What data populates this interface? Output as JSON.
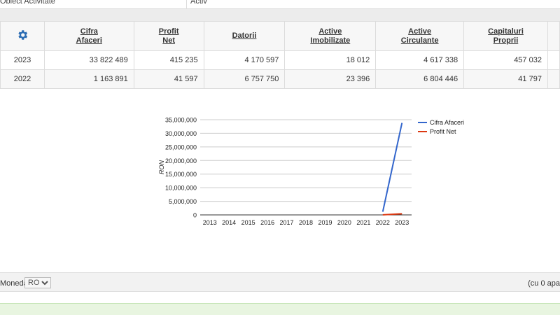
{
  "topbar": {
    "label": "Obiect Activitate",
    "value": "Activ"
  },
  "table": {
    "columns": [
      {
        "l1": "Cifra",
        "l2": "Afaceri"
      },
      {
        "l1": "Profit",
        "l2": "Net"
      },
      {
        "l1": "Datorii",
        "l2": ""
      },
      {
        "l1": "Active",
        "l2": "Imobilizate"
      },
      {
        "l1": "Active",
        "l2": "Circulante"
      },
      {
        "l1": "Capitaluri",
        "l2": "Proprii"
      }
    ],
    "rows": [
      {
        "year": "2023",
        "cells": [
          "33 822 489",
          "415 235",
          "4 170 597",
          "18 012",
          "4 617 338",
          "457 032"
        ]
      },
      {
        "year": "2022",
        "cells": [
          "1 163 891",
          "41 597",
          "6 757 750",
          "23 396",
          "6 804 446",
          "41 797"
        ]
      }
    ]
  },
  "chart_data": {
    "type": "line",
    "x": [
      "2013",
      "2014",
      "2015",
      "2016",
      "2017",
      "2018",
      "2019",
      "2020",
      "2021",
      "2022",
      "2023"
    ],
    "series": [
      {
        "name": "Cifra Afaceri",
        "color": "#3366cc",
        "values": [
          null,
          null,
          null,
          null,
          null,
          null,
          null,
          null,
          null,
          1163891,
          33822489
        ]
      },
      {
        "name": "Profit Net",
        "color": "#dc3912",
        "values": [
          null,
          null,
          null,
          null,
          null,
          null,
          null,
          null,
          null,
          41597,
          415235
        ]
      }
    ],
    "ylabel": "RON",
    "ylim": [
      0,
      35000000
    ],
    "yticks": [
      "0",
      "5,000,000",
      "10,000,000",
      "15,000,000",
      "20,000,000",
      "25,000,000",
      "30,000,000",
      "35,000,000"
    ],
    "grid": true,
    "legend": "right"
  },
  "footer": {
    "currency_label": "Moneda",
    "currency_value": "RON",
    "right_text": "(cu 0 apa"
  }
}
